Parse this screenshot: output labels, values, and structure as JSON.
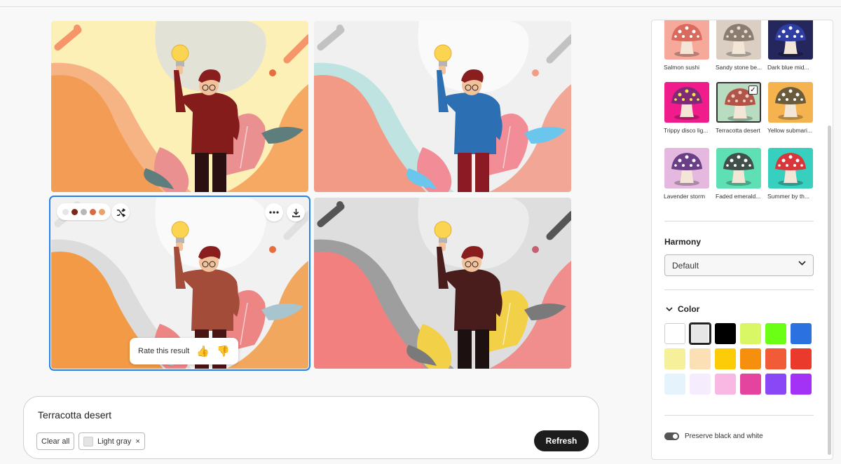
{
  "cards": [
    {
      "bg": "#fdf0b6",
      "blob_back": "#e2e2d6",
      "blob_main": "#f39c55",
      "blob_ring": "#f6b383",
      "accent": "#f59569",
      "shirt": "#841c1c",
      "pants": "#2a1010",
      "shoes": "#a01818",
      "leaf": "#ea9090",
      "leaf2": "#5d7e7c",
      "dot": "#e66d3e"
    },
    {
      "bg": "#f0f0f0",
      "blob_back": "#fafafa",
      "blob_main": "#f29a86",
      "blob_ring": "#bfe3e1",
      "accent": "#c2c2c2",
      "shirt": "#2d6fb3",
      "pants": "#8b1a24",
      "shoes": "#2b68a8",
      "leaf": "#f28c96",
      "leaf2": "#6ac6ec",
      "dot": "#f39c86"
    },
    {
      "bg": "#f1f1f1",
      "blob_back": "#fafafa",
      "blob_main": "#f29a45",
      "blob_ring": "#dcdcdc",
      "accent": "#e0e0e0",
      "shirt": "#a44c3a",
      "pants": "#4a1414",
      "shoes": "#7c1c1c",
      "leaf": "#ee8585",
      "leaf2": "#a8c5cf",
      "dot": "#e86d3e"
    },
    {
      "bg": "#dedede",
      "blob_back": "#ececec",
      "blob_main": "#f2807f",
      "blob_ring": "#9e9e9e",
      "accent": "#555555",
      "shirt": "#4a1d1d",
      "pants": "#1c1010",
      "shoes": "#1c1010",
      "leaf": "#f2d048",
      "leaf2": "#7a7a7a",
      "dot": "#c56171"
    }
  ],
  "selected_card": {
    "swatches": [
      "#e6e6e6",
      "#7b2a18",
      "#b7b7b7",
      "#d86a43",
      "#eea06c"
    ],
    "shuffle_icon": "shuffle-icon",
    "more_icon": "more-icon",
    "download_icon": "download-icon",
    "rate_label": "Rate this result",
    "thumbs_up": "👍",
    "thumbs_down": "👎"
  },
  "prompt": {
    "text": "Terracotta desert",
    "clear_all": "Clear all",
    "chip_label": "Light gray",
    "chip_close": "×",
    "refresh_label": "Refresh"
  },
  "panel": {
    "styles": [
      {
        "label": "Salmon sushi",
        "bg": "#f6a99a",
        "cap": "#d96b5e",
        "spot": "#fff"
      },
      {
        "label": "Sandy stone be...",
        "bg": "#dbcfc3",
        "cap": "#8d7d71",
        "spot": "#e7ddd3"
      },
      {
        "label": "Dark blue mid...",
        "bg": "#25265b",
        "cap": "#2f3ea5",
        "spot": "#ffffff"
      },
      {
        "label": "Trippy disco lig...",
        "bg": "#f11c8c",
        "cap": "#7f2a78",
        "spot": "#f5e844"
      },
      {
        "label": "Terracotta desert",
        "bg": "#b7dcc0",
        "cap": "#b35449",
        "spot": "#f3d2c5",
        "selected": true
      },
      {
        "label": "Yellow submari...",
        "bg": "#f5b350",
        "cap": "#6a5b3c",
        "spot": "#fff"
      },
      {
        "label": "Lavender storm",
        "bg": "#e5b8df",
        "cap": "#6a3f88",
        "spot": "#fff"
      },
      {
        "label": "Faded emerald...",
        "bg": "#5ee0b4",
        "cap": "#404f49",
        "spot": "#fff"
      },
      {
        "label": "Summer by th...",
        "bg": "#37cfbd",
        "cap": "#d8363a",
        "spot": "#fff"
      }
    ],
    "harmony_title": "Harmony",
    "harmony_value": "Default",
    "color_title": "Color",
    "colors": [
      "#ffffff",
      "#e6e6e6",
      "#000000",
      "#d9f765",
      "#6aff14",
      "#2b71e0",
      "#f7f09a",
      "#fbe0b5",
      "#fccc08",
      "#f68f0e",
      "#f25b37",
      "#ea3a2c",
      "#e5f3fd",
      "#f5ecfd",
      "#f8b8e3",
      "#e5449e",
      "#8a47f6",
      "#a431f6"
    ],
    "selected_color_index": 1,
    "preserve_label": "Preserve black and white"
  }
}
